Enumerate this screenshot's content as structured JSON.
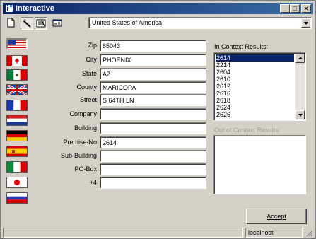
{
  "window": {
    "title": "Interactive",
    "controls": {
      "minimize": "_",
      "maximize": "□",
      "close": "×"
    }
  },
  "toolbar": {
    "tools": [
      "new-document-icon",
      "magic-wand-icon",
      "list-view-icon",
      "properties-icon"
    ],
    "country": "United States of America"
  },
  "flags": [
    "usa",
    "canada",
    "mexico",
    "united-kingdom",
    "france",
    "netherlands",
    "germany",
    "spain",
    "italy",
    "japan",
    "russia"
  ],
  "form": {
    "zip": {
      "label": "Zip",
      "value": "85043"
    },
    "city": {
      "label": "City",
      "value": "PHOENIX"
    },
    "state": {
      "label": "State",
      "value": "AZ"
    },
    "county": {
      "label": "County",
      "value": "MARICOPA"
    },
    "street": {
      "label": "Street",
      "value": "S 64TH LN"
    },
    "company": {
      "label": "Company",
      "value": ""
    },
    "building": {
      "label": "Building",
      "value": ""
    },
    "premise": {
      "label": "Premise-No",
      "value": "2614"
    },
    "subbuilding": {
      "label": "Sub-Building",
      "value": ""
    },
    "pobox": {
      "label": "PO-Box",
      "value": ""
    },
    "plus4": {
      "label": "+4",
      "value": ""
    }
  },
  "results": {
    "in_context_label": "In Context Results:",
    "in_context": [
      "2614",
      "2214",
      "2604",
      "2610",
      "2612",
      "2616",
      "2618",
      "2624",
      "2626"
    ],
    "selected_index": 0,
    "out_context_label": "Out of Context Results:"
  },
  "accept_label": "Accept",
  "status": {
    "left": "",
    "right": "localhost"
  }
}
